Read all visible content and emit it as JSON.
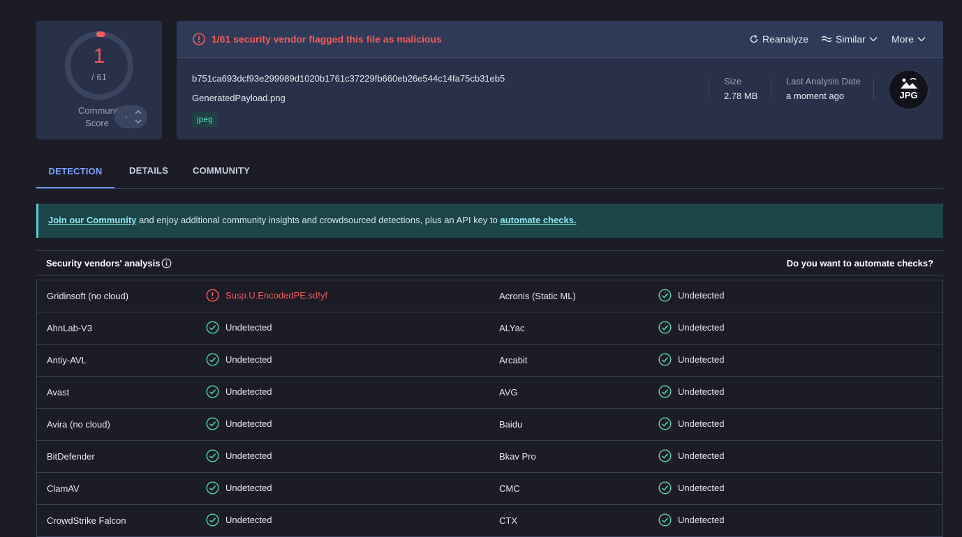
{
  "score": {
    "detections": "1",
    "total": "/ 61",
    "label_line1": "Community",
    "label_line2": "Score",
    "detection_fraction": 0.0164
  },
  "header": {
    "alert": "1/61 security vendor flagged this file as malicious",
    "actions": {
      "reanalyze": "Reanalyze",
      "similar": "Similar",
      "more": "More"
    },
    "hash": "b751ca693dcf93e299989d1020b1761c37229fb660eb26e544c14fa75cb31eb5",
    "filename": "GeneratedPayload.png",
    "tag": "jpeg",
    "size_label": "Size",
    "size_value": "2.78 MB",
    "date_label": "Last Analysis Date",
    "date_value": "a moment ago",
    "filetype": "JPG"
  },
  "tabs": {
    "detection": "DETECTION",
    "details": "DETAILS",
    "community": "COMMUNITY"
  },
  "banner": {
    "link1": "Join our Community",
    "middle": " and enjoy additional community insights and crowdsourced detections, plus an API key to ",
    "link2": "automate checks."
  },
  "vendors": {
    "title": "Security vendors' analysis",
    "automate_question": "Do you want to automate checks?",
    "rows": [
      {
        "left_name": "Gridinsoft (no cloud)",
        "left_result": "Susp.U.EncodedPE.sd!yf",
        "left_status": "malicious",
        "right_name": "Acronis (Static ML)",
        "right_result": "Undetected",
        "right_status": "undetected"
      },
      {
        "left_name": "AhnLab-V3",
        "left_result": "Undetected",
        "left_status": "undetected",
        "right_name": "ALYac",
        "right_result": "Undetected",
        "right_status": "undetected"
      },
      {
        "left_name": "Antiy-AVL",
        "left_result": "Undetected",
        "left_status": "undetected",
        "right_name": "Arcabit",
        "right_result": "Undetected",
        "right_status": "undetected"
      },
      {
        "left_name": "Avast",
        "left_result": "Undetected",
        "left_status": "undetected",
        "right_name": "AVG",
        "right_result": "Undetected",
        "right_status": "undetected"
      },
      {
        "left_name": "Avira (no cloud)",
        "left_result": "Undetected",
        "left_status": "undetected",
        "right_name": "Baidu",
        "right_result": "Undetected",
        "right_status": "undetected"
      },
      {
        "left_name": "BitDefender",
        "left_result": "Undetected",
        "left_status": "undetected",
        "right_name": "Bkav Pro",
        "right_result": "Undetected",
        "right_status": "undetected"
      },
      {
        "left_name": "ClamAV",
        "left_result": "Undetected",
        "left_status": "undetected",
        "right_name": "CMC",
        "right_result": "Undetected",
        "right_status": "undetected"
      },
      {
        "left_name": "CrowdStrike Falcon",
        "left_result": "Undetected",
        "left_status": "undetected",
        "right_name": "CTX",
        "right_result": "Undetected",
        "right_status": "undetected"
      }
    ]
  },
  "colors": {
    "malicious": "#f25b5b",
    "undetected": "#4fd1a5",
    "accent": "#6f95ff"
  }
}
